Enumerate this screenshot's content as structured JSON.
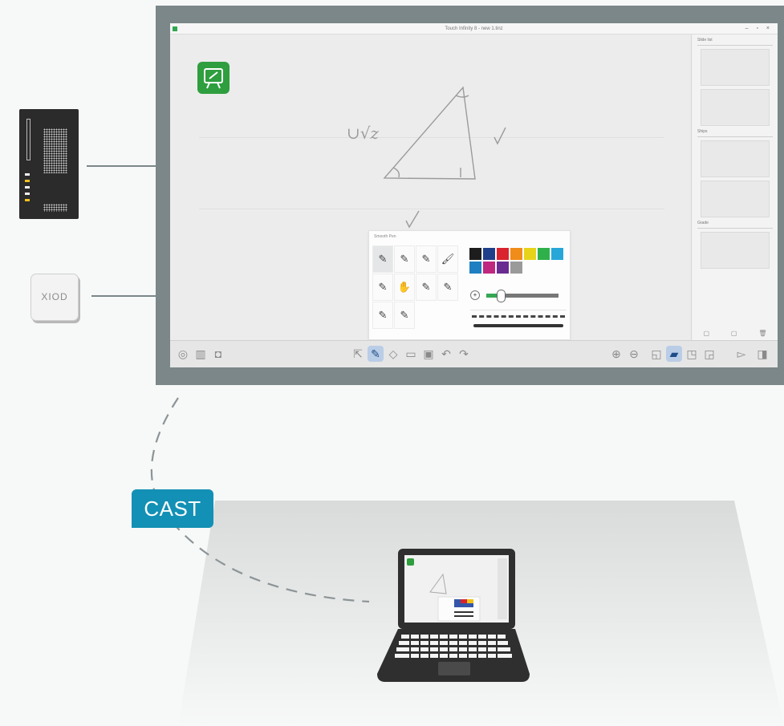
{
  "screen": {
    "window_title": "Touch Infinity 8 - new 1.tinz",
    "window_controls": "– ▫ ×",
    "side_headers": [
      "Slide list",
      "Ships",
      "Grade"
    ],
    "side_footer": [
      "▢",
      "▢",
      "🗑"
    ],
    "pen_popup_title": "Smooth Pen",
    "pen_tools": [
      "✎",
      "✎",
      "✎",
      "🖌",
      "✎",
      "✋",
      "✎",
      "✎",
      "✎",
      "✎"
    ],
    "size_minus": "+",
    "colors": [
      "#1d1d1d",
      "#1f3f8a",
      "#d9232e",
      "#f08c1a",
      "#e7d31a",
      "#2fb04b",
      "#27a7d8",
      "#1f7fc0",
      "#c0277f",
      "#6a2c91",
      "#9a9a9a"
    ],
    "pen_size_fraction": 0.2,
    "sketch_text": "∪√z"
  },
  "toolbar": {
    "left": [
      "◎",
      "▥",
      "◘"
    ],
    "center": [
      "⇱",
      "✎",
      "◇",
      "▭",
      "▣",
      "↶",
      "↷"
    ],
    "right": [
      "⊕",
      "⊖",
      "◱",
      "▰",
      "◳",
      "◲",
      "▻",
      "◨"
    ]
  },
  "devices": {
    "dongle_label": "XIOD"
  },
  "cast_label": "CAST",
  "colors": {
    "frame": "#7b8789",
    "cast_badge": "#1390b5",
    "app_icon": "#2e9e3e",
    "laptop": "#2f2f2f"
  }
}
